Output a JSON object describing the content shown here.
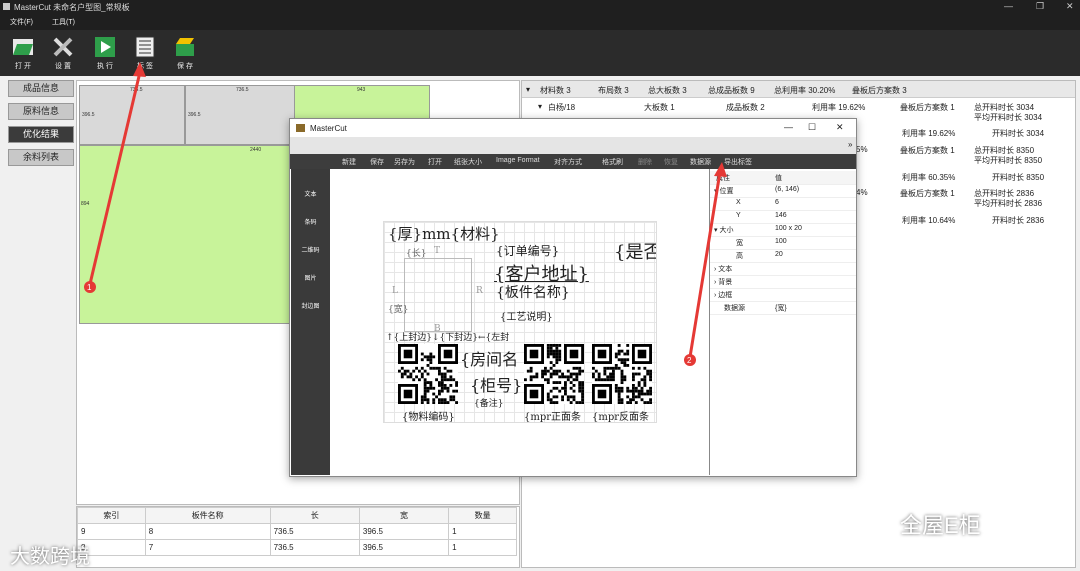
{
  "window": {
    "title": "MasterCut 未命名户型图_常规板"
  },
  "menu": [
    "文件(F)",
    "工具(T)"
  ],
  "toolbar": [
    {
      "label": "打 开",
      "icon": "open-folder-icon"
    },
    {
      "label": "设 置",
      "icon": "tools-icon"
    },
    {
      "label": "执 行",
      "icon": "play-icon"
    },
    {
      "label": "标 签",
      "icon": "label-icon"
    },
    {
      "label": "保 存",
      "icon": "save-icon"
    }
  ],
  "nav": [
    "成品信息",
    "原料信息",
    "优化结果",
    "余料列表"
  ],
  "layout_pieces": [
    "736.5",
    "736.5",
    "396.5",
    "396.5",
    "943",
    "2440",
    "894"
  ],
  "board_table": {
    "headers": [
      "索引",
      "板件名称",
      "长",
      "宽",
      "数量"
    ],
    "rows": [
      [
        "9",
        "8",
        "736.5",
        "396.5",
        "1"
      ],
      [
        "8",
        "7",
        "736.5",
        "396.5",
        "1"
      ]
    ]
  },
  "summary_header": [
    "材料数 3",
    "布局数 3",
    "总大板数 3",
    "总成品板数 9",
    "总利用率 30.20%",
    "叠板后方案数 3"
  ],
  "summary": {
    "r1": [
      "白杨/18",
      "大板数 1",
      "成品板数 2",
      "利用率 19.62%",
      "叠板后方案数 1",
      "总开料时长 3034"
    ],
    "r1b": "平均开料时长 3034",
    "r2": [
      "利用率 19.62%",
      "开料时长 3034"
    ],
    "r3a": [
      "5%",
      "叠板后方案数 1",
      "总开料时长 8350"
    ],
    "r3b": "平均开料时长 8350",
    "r4": [
      "利用率 60.35%",
      "开料时长 8350"
    ],
    "r5a": [
      "4%",
      "叠板后方案数 1",
      "总开料时长 2836"
    ],
    "r5b": "平均开料时长 2836",
    "r6": [
      "利用率 10.64%",
      "开料时长 2836"
    ]
  },
  "modal": {
    "title": "MasterCut",
    "tools": [
      "新建",
      "保存",
      "另存为",
      "打开",
      "纸张大小",
      "Image Format",
      "对齐方式",
      "格式刷",
      "删除",
      "恢复",
      "数据源",
      "导出标签"
    ],
    "side": [
      "文本",
      "条码",
      "二维码",
      "图片",
      "封边图"
    ],
    "label_texts": {
      "thick": "{厚}mm{材料}",
      "len": "{长}",
      "t": "T",
      "order": "{订单编号}",
      "is": "{是否",
      "addr": "{客户地址}",
      "l": "L",
      "r": "R",
      "board": "{板件名称}",
      "wid": "{宽}",
      "proc": "{工艺说明}",
      "edges": "↑{上封边}↓{下封边}←{左封",
      "b": "B",
      "room": "{房间名",
      "cab": "{柜号}",
      "note": "{备注}",
      "code": "{物料编码}",
      "mpr1": "{mpr正面条",
      "mpr2": "{mpr反面条"
    },
    "props": {
      "header_k": "属性",
      "header_v": "值",
      "pos": "位置",
      "pos_v": "(6, 146)",
      "x": "X",
      "x_v": "6",
      "y": "Y",
      "y_v": "146",
      "size": "大小",
      "size_v": "100 x 20",
      "w": "宽",
      "w_v": "100",
      "h": "高",
      "h_v": "20",
      "text": "文本",
      "bg": "背景",
      "border": "边框",
      "ds": "数据源",
      "ds_v": "{宽}"
    }
  },
  "watermark": {
    "right": "全屋E柜",
    "left": "大数跨境"
  },
  "markers": [
    "1",
    "2"
  ],
  "colors": {
    "accent_green": "#c8f39a",
    "arrow_red": "#e53935",
    "toolbar_bg": "#2b2b2b"
  }
}
